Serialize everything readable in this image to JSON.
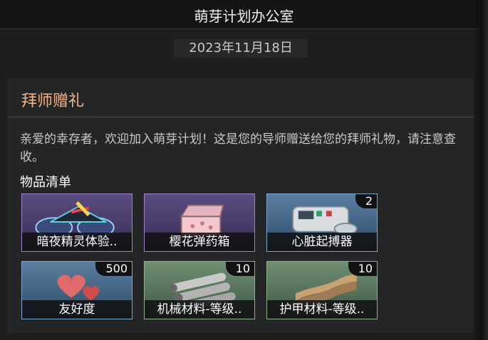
{
  "window": {
    "title": "萌芽计划办公室"
  },
  "date": "2023年11月18日",
  "panel": {
    "title": "拜师赠礼",
    "message": "亲爱的幸存者，欢迎加入萌芽计划！这是您的导师赠送给您的拜师礼物，请注意查收。",
    "list_title": "物品清单"
  },
  "items": [
    {
      "name": "暗夜精灵体验..",
      "count": "",
      "rarity": "purple",
      "icon": "vehicle-icon"
    },
    {
      "name": "樱花弹药箱",
      "count": "",
      "rarity": "purple",
      "icon": "ammo-box-icon"
    },
    {
      "name": "心脏起搏器",
      "count": "2",
      "rarity": "blue",
      "icon": "defibrillator-icon"
    },
    {
      "name": "友好度",
      "count": "500",
      "rarity": "blue",
      "icon": "hearts-icon"
    },
    {
      "name": "机械材料-等级..",
      "count": "10",
      "rarity": "green",
      "icon": "mechanical-parts-icon"
    },
    {
      "name": "护甲材料-等级..",
      "count": "10",
      "rarity": "green",
      "icon": "armor-material-icon"
    }
  ],
  "colors": {
    "accent_title": "#f1b58a",
    "purple": "#9d7ec9",
    "blue": "#7aa7cf",
    "green": "#8fb38f"
  }
}
